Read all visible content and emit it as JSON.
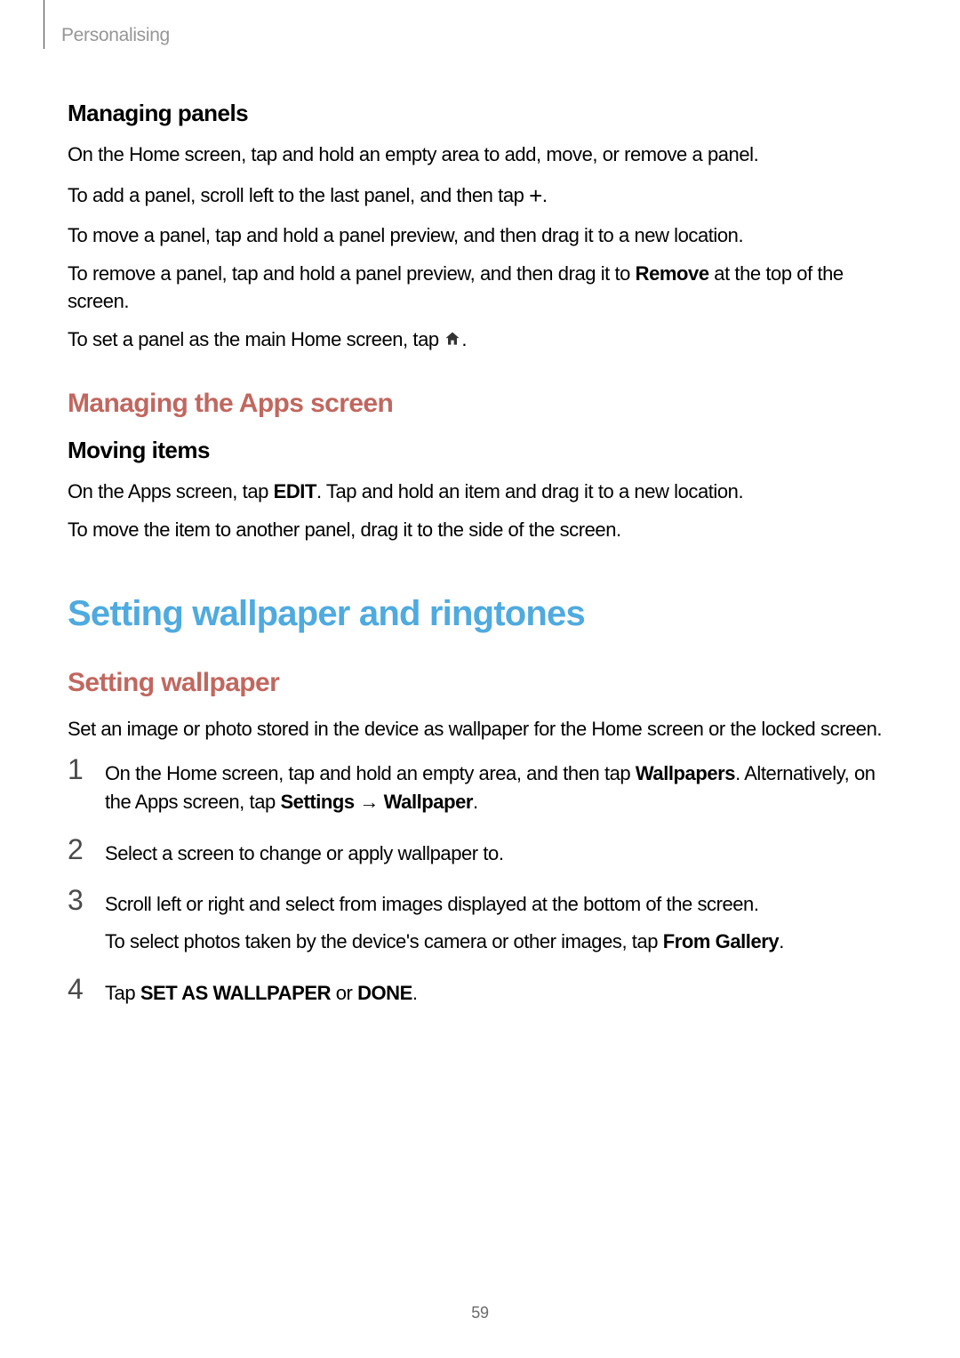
{
  "breadcrumb": "Personalising",
  "section_managing_panels": {
    "heading": "Managing panels",
    "p1": "On the Home screen, tap and hold an empty area to add, move, or remove a panel.",
    "p2_pre": "To add a panel, scroll left to the last panel, and then tap ",
    "p2_icon": "plus-icon",
    "p2_post": ".",
    "p3": "To move a panel, tap and hold a panel preview, and then drag it to a new location.",
    "p4_pre": "To remove a panel, tap and hold a panel preview, and then drag it to ",
    "p4_bold": "Remove",
    "p4_post": " at the top of the screen.",
    "p5_pre": "To set a panel as the main Home screen, tap ",
    "p5_icon": "home-icon",
    "p5_post": "."
  },
  "section_managing_apps": {
    "heading": "Managing the Apps screen",
    "sub_heading": "Moving items",
    "p1_pre": "On the Apps screen, tap ",
    "p1_bold": "EDIT",
    "p1_post": ". Tap and hold an item and drag it to a new location.",
    "p2": "To move the item to another panel, drag it to the side of the screen."
  },
  "section_setting_wallpaper_ringtones": {
    "heading": "Setting wallpaper and ringtones"
  },
  "section_setting_wallpaper": {
    "heading": "Setting wallpaper",
    "intro": "Set an image or photo stored in the device as wallpaper for the Home screen or the locked screen.",
    "steps": [
      {
        "num": "1",
        "parts": [
          {
            "text": "On the Home screen, tap and hold an empty area, and then tap "
          },
          {
            "text": "Wallpapers",
            "bold": true
          },
          {
            "text": ". Alternatively, on the Apps screen, tap "
          },
          {
            "text": "Settings",
            "bold": true
          },
          {
            "text": " → ",
            "arrow": true
          },
          {
            "text": "Wallpaper",
            "bold": true
          },
          {
            "text": "."
          }
        ]
      },
      {
        "num": "2",
        "parts": [
          {
            "text": "Select a screen to change or apply wallpaper to."
          }
        ]
      },
      {
        "num": "3",
        "parts": [
          {
            "text": "Scroll left or right and select from images displayed at the bottom of the screen."
          }
        ],
        "sub_parts": [
          {
            "text": "To select photos taken by the device's camera or other images, tap "
          },
          {
            "text": "From Gallery",
            "bold": true
          },
          {
            "text": "."
          }
        ]
      },
      {
        "num": "4",
        "parts": [
          {
            "text": "Tap "
          },
          {
            "text": "SET AS WALLPAPER",
            "bold": true
          },
          {
            "text": " or "
          },
          {
            "text": "DONE",
            "bold": true
          },
          {
            "text": "."
          }
        ]
      }
    ]
  },
  "page_number": "59"
}
